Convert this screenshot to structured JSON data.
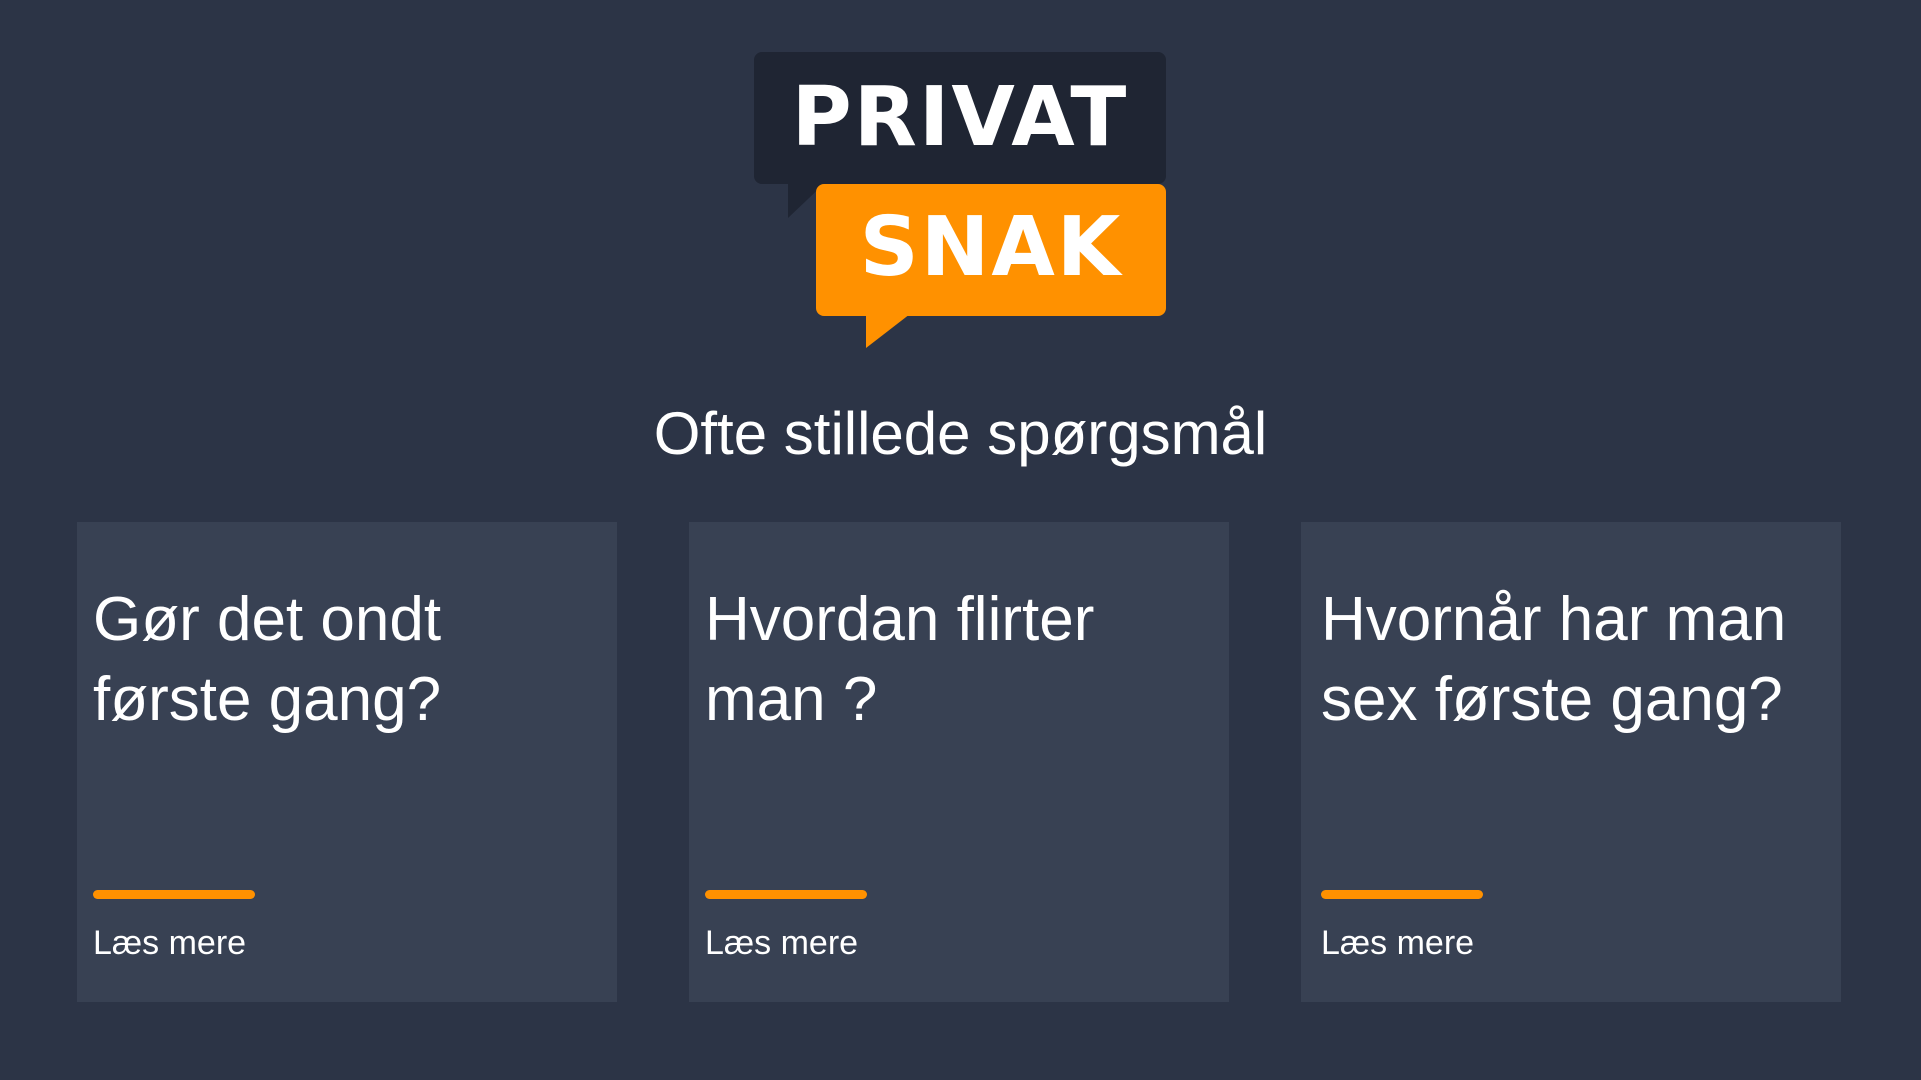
{
  "brand": {
    "logo_top": "PRIVAT",
    "logo_bottom": "SNAK",
    "colors": {
      "background": "#2c3446",
      "card": "#384153",
      "logo_dark": "#1f2533",
      "accent": "#ff9100",
      "text": "#ffffff"
    }
  },
  "main": {
    "title": "Ofte stillede spørgsmål",
    "cards": [
      {
        "title": "Gør det ondt første gang?",
        "link_label": "Læs mere"
      },
      {
        "title": "Hvordan flirter man ?",
        "link_label": "Læs mere"
      },
      {
        "title": "Hvornår har man sex første gang?",
        "link_label": "Læs mere"
      }
    ]
  }
}
